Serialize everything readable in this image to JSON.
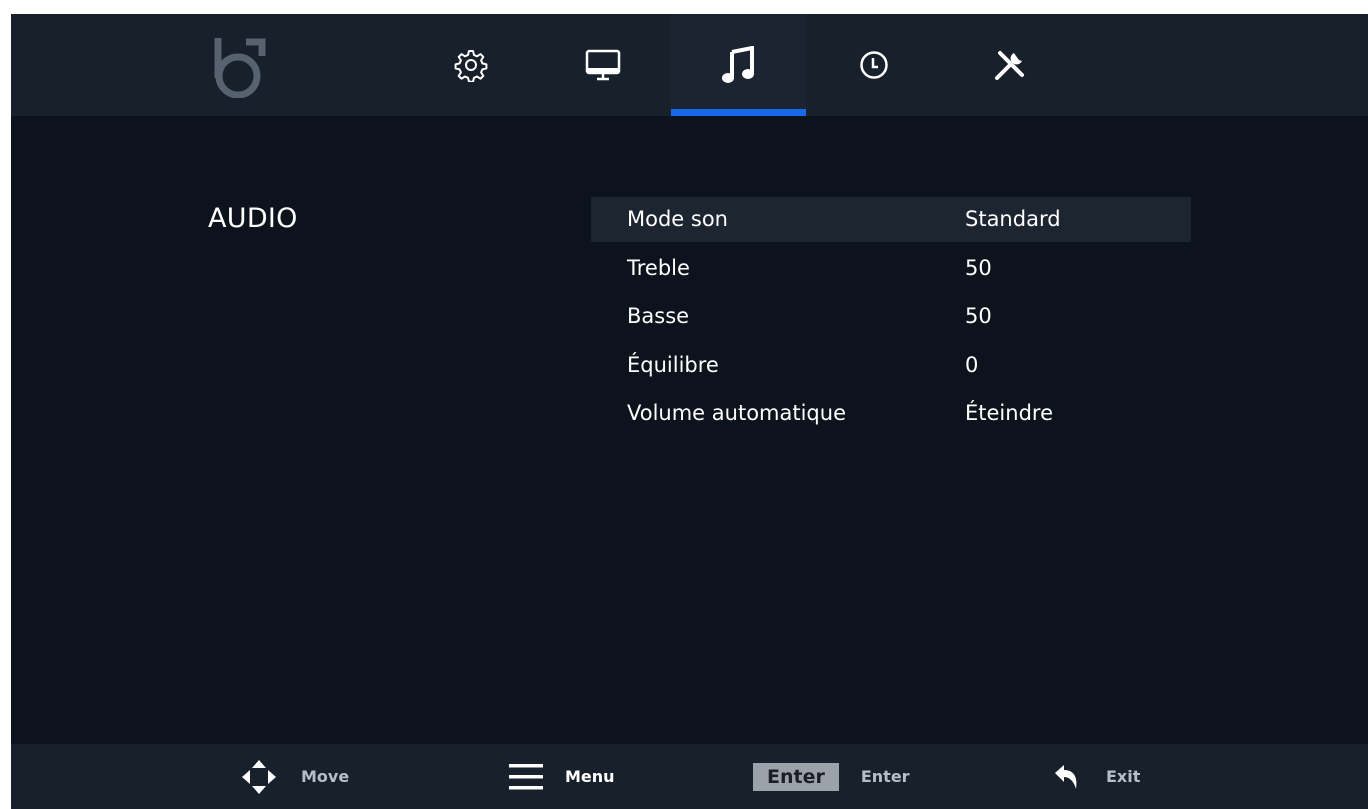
{
  "tabs": [
    {
      "icon": "gear-icon",
      "active": false
    },
    {
      "icon": "monitor-icon",
      "active": false
    },
    {
      "icon": "music-note-icon",
      "active": true
    },
    {
      "icon": "clock-icon",
      "active": false
    },
    {
      "icon": "tools-icon",
      "active": false
    }
  ],
  "colors": {
    "accent": "#1769e8",
    "background": "#0d131d",
    "bar": "#18202b",
    "selected_row": "#1d2531"
  },
  "section_title": "AUDIO",
  "menu": {
    "selected_index": 0,
    "items": [
      {
        "label": "Mode son",
        "value": "Standard"
      },
      {
        "label": "Treble",
        "value": "50"
      },
      {
        "label": "Basse",
        "value": "50"
      },
      {
        "label": "Équilibre",
        "value": "0"
      },
      {
        "label": "Volume automatique",
        "value": "Éteindre"
      }
    ]
  },
  "footer": {
    "move": {
      "icon": "dpad-icon",
      "label": "Move"
    },
    "menu": {
      "icon": "hamburger-icon",
      "label": "Menu"
    },
    "enter": {
      "key": "Enter",
      "label": "Enter"
    },
    "exit": {
      "icon": "return-arrow-icon",
      "label": "Exit"
    }
  }
}
